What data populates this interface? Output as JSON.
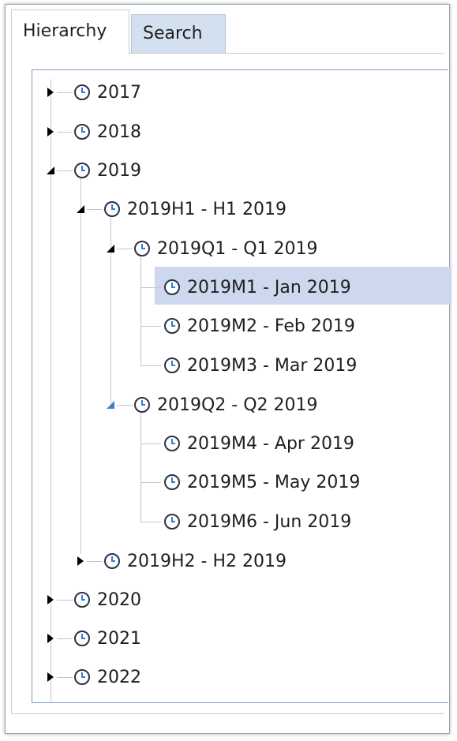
{
  "tabs": {
    "hierarchy": "Hierarchy",
    "search": "Search"
  },
  "tree": {
    "y2017": "2017",
    "y2018": "2018",
    "y2019": "2019",
    "h1": "2019H1 - H1 2019",
    "q1": "2019Q1 - Q1 2019",
    "m1": "2019M1 - Jan 2019",
    "m2": "2019M2 - Feb 2019",
    "m3": "2019M3 - Mar 2019",
    "q2": "2019Q2 - Q2 2019",
    "m4": "2019M4 - Apr 2019",
    "m5": "2019M5 - May 2019",
    "m6": "2019M6 - Jun 2019",
    "h2": "2019H2 - H2 2019",
    "y2020": "2020",
    "y2021": "2021",
    "y2022": "2022"
  },
  "colors": {
    "selected": "#cdd8ef",
    "tab_inactive": "#d3e0f0",
    "expander_active": "#3d7fc8"
  },
  "icons": {
    "node": "clock-icon",
    "collapsed": "triangle-right-icon",
    "expanded": "triangle-down-left-icon"
  }
}
